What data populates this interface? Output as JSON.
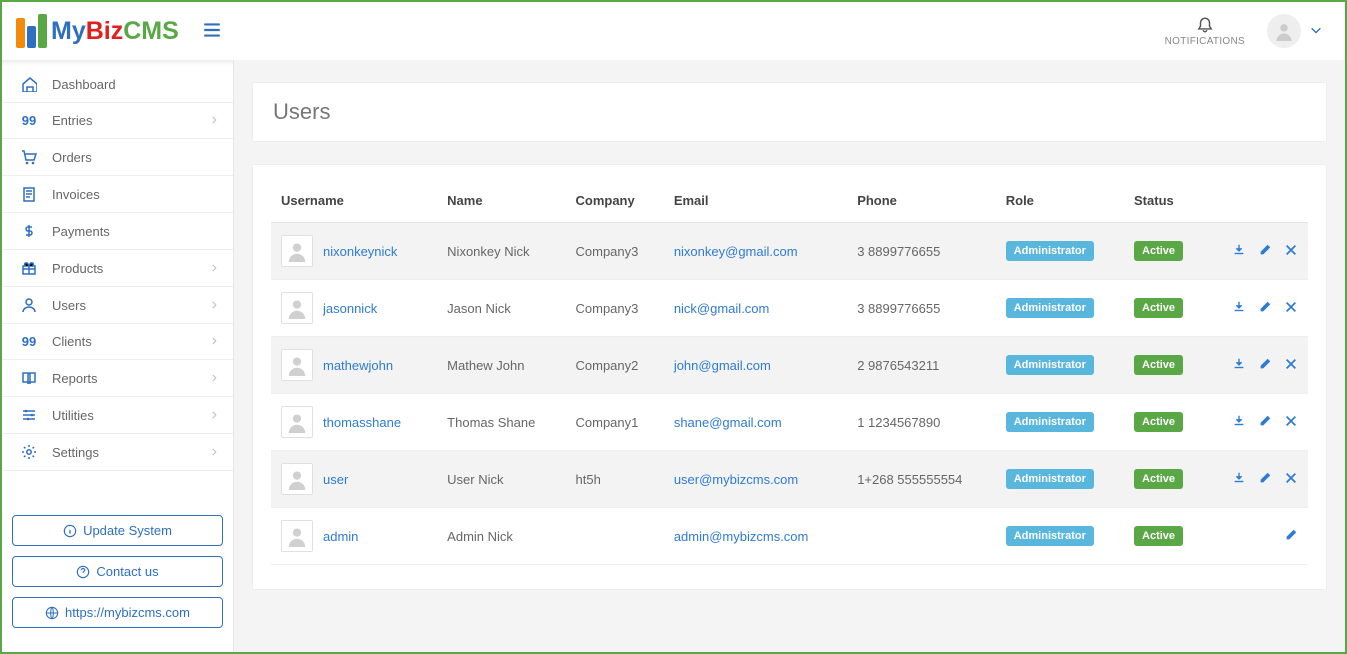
{
  "brand": {
    "my": "My",
    "biz": "Biz",
    "cms": "CMS"
  },
  "topbar": {
    "notifications_label": "NOTIFICATIONS"
  },
  "sidebar": {
    "items": [
      {
        "label": "Dashboard",
        "icon": "home",
        "chev": false
      },
      {
        "label": "Entries",
        "icon": "num99",
        "chev": true
      },
      {
        "label": "Orders",
        "icon": "cart",
        "chev": false
      },
      {
        "label": "Invoices",
        "icon": "invoice",
        "chev": false
      },
      {
        "label": "Payments",
        "icon": "dollar",
        "chev": false
      },
      {
        "label": "Products",
        "icon": "gift",
        "chev": true
      },
      {
        "label": "Users",
        "icon": "user",
        "chev": true
      },
      {
        "label": "Clients",
        "icon": "num99",
        "chev": true
      },
      {
        "label": "Reports",
        "icon": "book",
        "chev": true
      },
      {
        "label": "Utilities",
        "icon": "sliders",
        "chev": true
      },
      {
        "label": "Settings",
        "icon": "gear",
        "chev": true
      }
    ],
    "footer": {
      "update_label": "Update System",
      "contact_label": "Contact us",
      "link_label": "https://mybizcms.com"
    }
  },
  "page": {
    "title": "Users"
  },
  "table": {
    "headers": {
      "username": "Username",
      "name": "Name",
      "company": "Company",
      "email": "Email",
      "phone": "Phone",
      "role": "Role",
      "status": "Status"
    },
    "rows": [
      {
        "username": "nixonkeynick",
        "name": "Nixonkey Nick",
        "company": "Company3",
        "email": "nixonkey@gmail.com",
        "phone": "3 8899776655",
        "role": "Administrator",
        "status": "Active",
        "actions": [
          "download",
          "edit",
          "delete"
        ]
      },
      {
        "username": "jasonnick",
        "name": "Jason Nick",
        "company": "Company3",
        "email": "nick@gmail.com",
        "phone": "3 8899776655",
        "role": "Administrator",
        "status": "Active",
        "actions": [
          "download",
          "edit",
          "delete"
        ]
      },
      {
        "username": "mathewjohn",
        "name": "Mathew John",
        "company": "Company2",
        "email": "john@gmail.com",
        "phone": "2 9876543211",
        "role": "Administrator",
        "status": "Active",
        "actions": [
          "download",
          "edit",
          "delete"
        ]
      },
      {
        "username": "thomasshane",
        "name": "Thomas Shane",
        "company": "Company1",
        "email": "shane@gmail.com",
        "phone": "1 1234567890",
        "role": "Administrator",
        "status": "Active",
        "actions": [
          "download",
          "edit",
          "delete"
        ]
      },
      {
        "username": "user",
        "name": "User Nick",
        "company": "ht5h",
        "email": "user@mybizcms.com",
        "phone": "1+268 555555554",
        "role": "Administrator",
        "status": "Active",
        "actions": [
          "download",
          "edit",
          "delete"
        ]
      },
      {
        "username": "admin",
        "name": "Admin Nick",
        "company": "",
        "email": "admin@mybizcms.com",
        "phone": "",
        "role": "Administrator",
        "status": "Active",
        "actions": [
          "edit"
        ]
      }
    ]
  }
}
